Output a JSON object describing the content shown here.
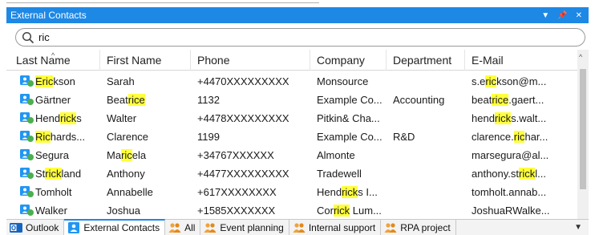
{
  "window": {
    "title": "External Contacts"
  },
  "search": {
    "value": "ric"
  },
  "columns": [
    "Last Name",
    "First Name",
    "Phone",
    "Company",
    "Department",
    "E-Mail"
  ],
  "rows": [
    {
      "cells": [
        [
          "",
          "Eric",
          "kson"
        ],
        [
          "Sarah"
        ],
        [
          "+4470XXXXXXXXX"
        ],
        [
          "Monsource"
        ],
        [
          ""
        ],
        [
          "s.e",
          "ric",
          "kson@m..."
        ]
      ]
    },
    {
      "cells": [
        [
          "Gärtner"
        ],
        [
          "Beat",
          "rice",
          ""
        ],
        [
          "1132"
        ],
        [
          "Example Co..."
        ],
        [
          "Accounting"
        ],
        [
          "beat",
          "rice",
          ".gaert..."
        ]
      ]
    },
    {
      "cells": [
        [
          "Hend",
          "rick",
          "s"
        ],
        [
          "Walter"
        ],
        [
          "+4478XXXXXXXXX"
        ],
        [
          "Pitkin& Cha..."
        ],
        [
          ""
        ],
        [
          "hend",
          "rick",
          "s.walt..."
        ]
      ]
    },
    {
      "cells": [
        [
          "",
          "Ric",
          "hards..."
        ],
        [
          "Clarence"
        ],
        [
          "1199"
        ],
        [
          "Example Co..."
        ],
        [
          "R&D"
        ],
        [
          "clarence.",
          "ric",
          "har..."
        ]
      ]
    },
    {
      "cells": [
        [
          "Segura"
        ],
        [
          "Ma",
          "ric",
          "ela"
        ],
        [
          "+34767XXXXXX"
        ],
        [
          "Almonte"
        ],
        [
          ""
        ],
        [
          "marsegura@al..."
        ]
      ]
    },
    {
      "cells": [
        [
          "St",
          "rick",
          "land"
        ],
        [
          "Anthony"
        ],
        [
          "+4477XXXXXXXXX"
        ],
        [
          "Tradewell"
        ],
        [
          ""
        ],
        [
          "anthony.st",
          "rick",
          "l..."
        ]
      ]
    },
    {
      "cells": [
        [
          "Tomholt"
        ],
        [
          "Annabelle"
        ],
        [
          "+617XXXXXXXX"
        ],
        [
          "Hend",
          "rick",
          "s I..."
        ],
        [
          ""
        ],
        [
          "tomholt.annab..."
        ]
      ]
    },
    {
      "cells": [
        [
          "Walker"
        ],
        [
          "Joshua"
        ],
        [
          "+1585XXXXXXX"
        ],
        [
          "Cor",
          "rick",
          " Lum..."
        ],
        [
          ""
        ],
        [
          "JoshuaRWalke..."
        ]
      ]
    }
  ],
  "tabs": [
    {
      "label": "Outlook",
      "icon": "outlook-icon"
    },
    {
      "label": "External Contacts",
      "icon": "contacts-icon",
      "active": true
    },
    {
      "label": "All",
      "icon": "group-icon"
    },
    {
      "label": "Event planning",
      "icon": "group-icon"
    },
    {
      "label": "Internal support",
      "icon": "group-icon"
    },
    {
      "label": "RPA project",
      "icon": "group-icon"
    }
  ],
  "colors": {
    "accent": "#1e88e5",
    "highlight": "#ffff3b",
    "contact_icon": "#2196f3",
    "presence_green": "#4caf50",
    "group_icon": "#f0a23c"
  }
}
